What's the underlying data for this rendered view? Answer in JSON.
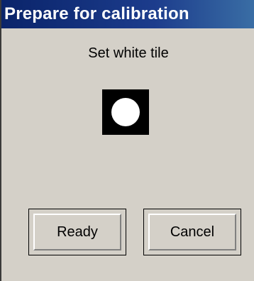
{
  "dialog": {
    "title": "Prepare for calibration",
    "prompt": "Set white tile",
    "icon": "white-tile-icon",
    "buttons": {
      "ready_label": "Ready",
      "cancel_label": "Cancel"
    }
  },
  "colors": {
    "titlebar": "#0a246a",
    "dialog_background": "#d4d0c8",
    "tile_background": "#000000",
    "tile_dot": "#ffffff"
  }
}
